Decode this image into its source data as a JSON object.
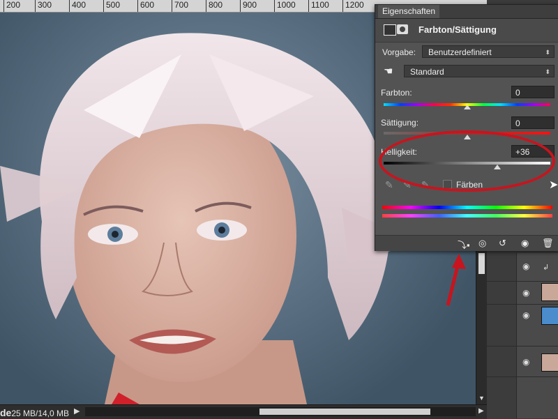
{
  "ruler": {
    "ticks": [
      "200",
      "300",
      "400",
      "500",
      "600",
      "700",
      "800",
      "900",
      "1000",
      "1100",
      "1200"
    ]
  },
  "status": {
    "doc_label": "de",
    "doc_size": "25 MB/14,0 MB"
  },
  "properties": {
    "tab": "Eigenschaften",
    "title": "Farbton/Sättigung",
    "preset_label": "Vorgabe:",
    "preset_value": "Benutzerdefiniert",
    "range_value": "Standard",
    "hue_label": "Farbton:",
    "hue_value": "0",
    "sat_label": "Sättigung:",
    "sat_value": "0",
    "light_label": "Helligkeit:",
    "light_value": "+36",
    "colorize_label": "Färben"
  },
  "levels": {
    "hue": 0.5,
    "saturation": 0.5,
    "lightness": 0.68
  },
  "colors": {
    "annotation": "#c8141e",
    "panel": "#535353",
    "accent": "#4a8ccc"
  },
  "icons": [
    "hand-icon",
    "eyedropper-icon",
    "eyedropper-plus-icon",
    "eyedropper-minus-icon",
    "clip-icon",
    "visibility-icon",
    "reset-icon",
    "eye-icon",
    "trash-icon"
  ]
}
